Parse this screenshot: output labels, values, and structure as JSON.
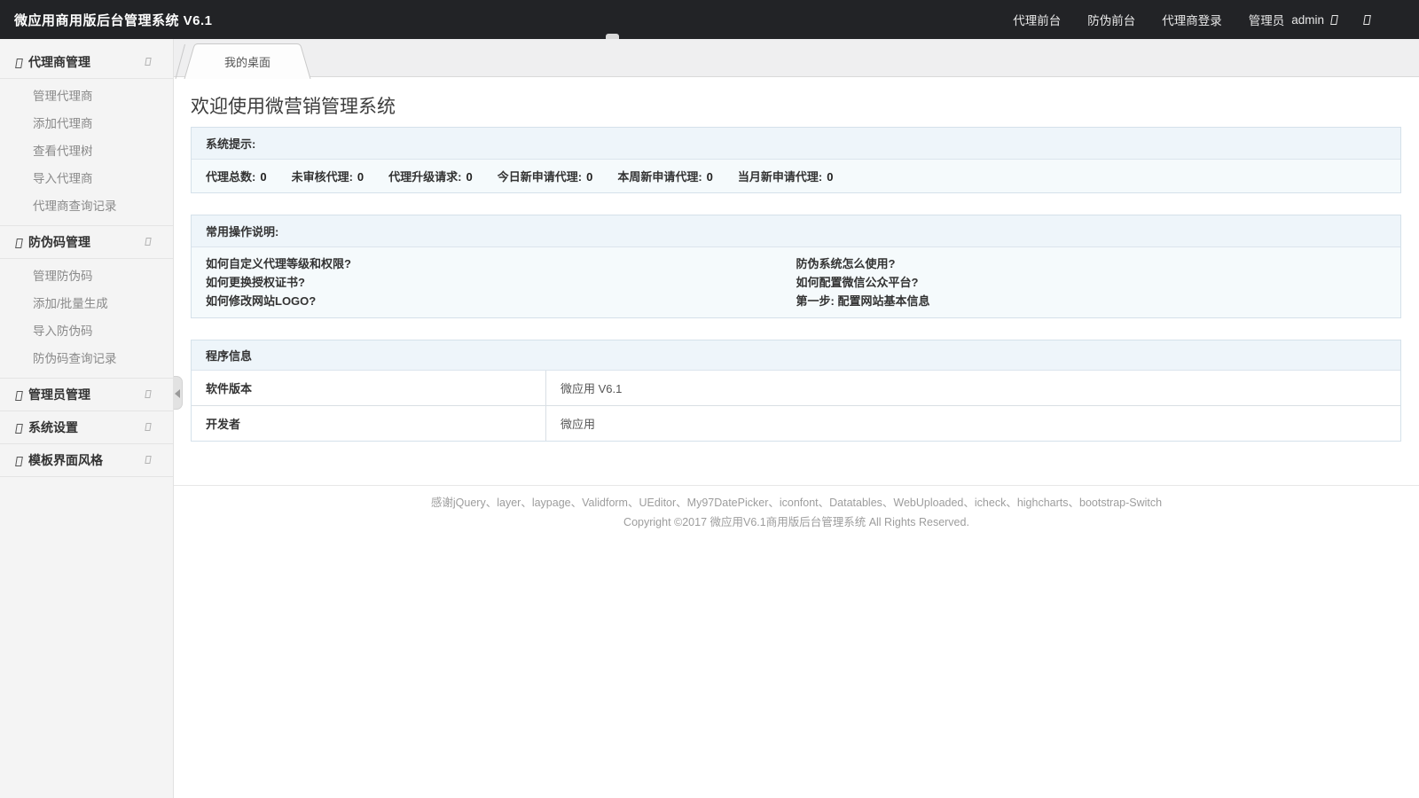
{
  "topbar": {
    "title": "微应用商用版后台管理系统 V6.1",
    "links": [
      {
        "label": "代理前台"
      },
      {
        "label": "防伪前台"
      },
      {
        "label": "代理商登录"
      }
    ],
    "admin_role": "管理员",
    "admin_name": "admin"
  },
  "sidebar": {
    "sections": [
      {
        "label": "代理商管理",
        "expanded": true,
        "children": [
          "管理代理商",
          "添加代理商",
          "查看代理树",
          "导入代理商",
          "代理商查询记录"
        ]
      },
      {
        "label": "防伪码管理",
        "expanded": true,
        "children": [
          "管理防伪码",
          "添加/批量生成",
          "导入防伪码",
          "防伪码查询记录"
        ]
      },
      {
        "label": "管理员管理",
        "expanded": false,
        "children": []
      },
      {
        "label": "系统设置",
        "expanded": false,
        "children": []
      },
      {
        "label": "模板界面风格",
        "expanded": false,
        "children": []
      }
    ]
  },
  "tabs": [
    {
      "label": "我的桌面",
      "active": true
    }
  ],
  "main": {
    "heading": "欢迎使用微营销管理系统",
    "system_tips": {
      "title": "系统提示:",
      "stats": [
        {
          "label": "代理总数:",
          "value": "0"
        },
        {
          "label": "未审核代理:",
          "value": "0"
        },
        {
          "label": "代理升级请求:",
          "value": "0"
        },
        {
          "label": "今日新申请代理:",
          "value": "0"
        },
        {
          "label": "本周新申请代理:",
          "value": "0"
        },
        {
          "label": "当月新申请代理:",
          "value": "0"
        }
      ]
    },
    "operations": {
      "title": "常用操作说明:",
      "left_links": [
        "如何自定义代理等级和权限?",
        "如何更换授权证书?",
        "如何修改网站LOGO?"
      ],
      "right_links": [
        "防伪系统怎么使用?",
        "如何配置微信公众平台?",
        "第一步: 配置网站基本信息"
      ]
    },
    "program_info": {
      "title": "程序信息",
      "rows": [
        {
          "label": "软件版本",
          "value": "微应用 V6.1"
        },
        {
          "label": "开发者",
          "value": "微应用"
        }
      ]
    }
  },
  "footer": {
    "thanks": "感谢jQuery、layer、laypage、Validform、UEditor、My97DatePicker、iconfont、Datatables、WebUploaded、icheck、highcharts、bootstrap-Switch",
    "copyright": "Copyright ©2017 微应用V6.1商用版后台管理系统 All Rights Reserved."
  },
  "colors": {
    "topbar_bg": "#222326",
    "sidebar_bg": "#f4f4f4",
    "panel_border": "#d5e1ea",
    "panel_header_bg": "#eef5fa",
    "panel_body_bg": "#f5fafc"
  }
}
